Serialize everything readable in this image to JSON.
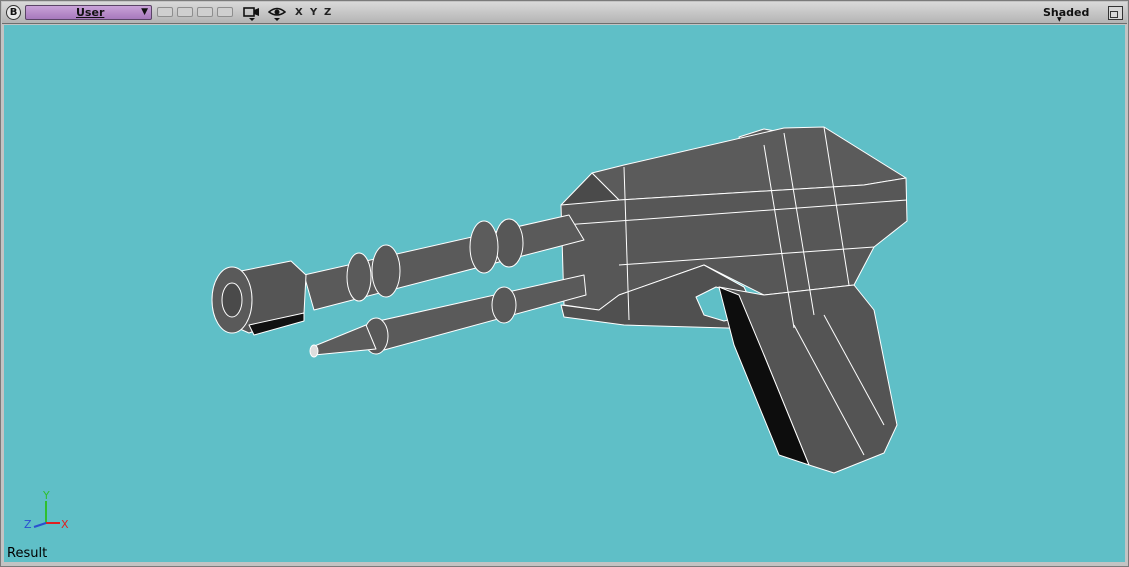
{
  "header": {
    "logo_letter": "B",
    "view_menu": {
      "label": "User"
    },
    "axis_labels": [
      "X",
      "Y",
      "Z"
    ],
    "shading_mode": "Shaded"
  },
  "viewport": {
    "background_color": "#5fbfc7",
    "view_name": "Result",
    "axes_gizmo": {
      "x_label": "X",
      "y_label": "Y",
      "z_label": "Z"
    }
  },
  "icons": [
    "blender-logo-icon",
    "camera-icon",
    "eye-icon",
    "maximize-icon"
  ]
}
